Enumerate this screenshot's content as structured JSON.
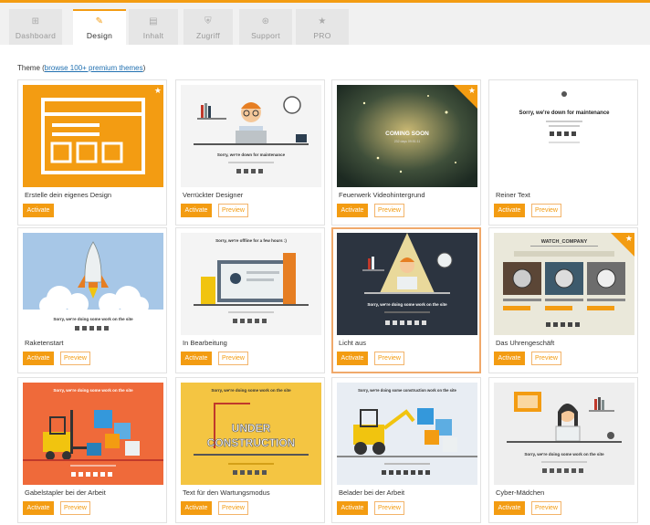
{
  "tabs": [
    {
      "label": "Dashboard",
      "icon": "dashboard-icon",
      "glyph": "⊞",
      "active": false
    },
    {
      "label": "Design",
      "icon": "brush-icon",
      "glyph": "✎",
      "active": true
    },
    {
      "label": "Inhalt",
      "icon": "document-icon",
      "glyph": "▤",
      "active": false
    },
    {
      "label": "Zugriff",
      "icon": "shield-icon",
      "glyph": "⛨",
      "active": false
    },
    {
      "label": "Support",
      "icon": "lifebuoy-icon",
      "glyph": "⊛",
      "active": false
    },
    {
      "label": "PRO",
      "icon": "star-icon",
      "glyph": "★",
      "active": false
    }
  ],
  "theme_header": {
    "label": "Theme",
    "link": "browse 100+ premium themes"
  },
  "buttons": {
    "activate": "Activate",
    "preview": "Preview"
  },
  "colors": {
    "accent": "#f39c12",
    "link": "#2271b1"
  },
  "themes": [
    {
      "name": "Erstelle dein eigenes Design",
      "premium": true,
      "preview": false,
      "selected": false,
      "thumb": "builder"
    },
    {
      "name": "Verrückter Designer",
      "premium": false,
      "preview": true,
      "selected": false,
      "thumb": "designer",
      "caption": "Sorry, we're down for maintenance"
    },
    {
      "name": "Feuerwerk Videohintergrund",
      "premium": true,
      "preview": true,
      "selected": false,
      "thumb": "fireworks",
      "caption": "COMING SOON",
      "sub": "232 days 09:51:11"
    },
    {
      "name": "Reiner Text",
      "premium": false,
      "preview": true,
      "selected": false,
      "thumb": "text",
      "caption": "Sorry, we're down for maintenance"
    },
    {
      "name": "Raketenstart",
      "premium": false,
      "preview": true,
      "selected": false,
      "thumb": "rocket",
      "caption": "Sorry, we're doing some work on the site"
    },
    {
      "name": "In Bearbeitung",
      "premium": false,
      "preview": true,
      "selected": false,
      "thumb": "construction",
      "caption": "Sorry, we're offline for a few hours :)"
    },
    {
      "name": "Licht aus",
      "premium": false,
      "preview": true,
      "selected": true,
      "thumb": "lightsout",
      "caption": "Sorry, we're doing some work on the site"
    },
    {
      "name": "Das Uhrengeschäft",
      "premium": true,
      "preview": true,
      "selected": false,
      "thumb": "watch",
      "caption": "WATCH_COMPANY"
    },
    {
      "name": "Gabelstapler bei der Arbeit",
      "premium": false,
      "preview": true,
      "selected": false,
      "thumb": "forklift",
      "caption": "Sorry, we're doing some work on the site"
    },
    {
      "name": "Text für den Wartungsmodus",
      "premium": false,
      "preview": true,
      "selected": false,
      "thumb": "underconstruction",
      "caption": "UNDER",
      "caption2": "CONSTRUCTION"
    },
    {
      "name": "Belader bei der Arbeit",
      "premium": false,
      "preview": true,
      "selected": false,
      "thumb": "loader",
      "caption": "Sorry, we're doing some construction work on the site"
    },
    {
      "name": "Cyber-Mädchen",
      "premium": false,
      "preview": true,
      "selected": false,
      "thumb": "cybergirl",
      "caption": "Sorry, we're doing some work on the site"
    }
  ]
}
